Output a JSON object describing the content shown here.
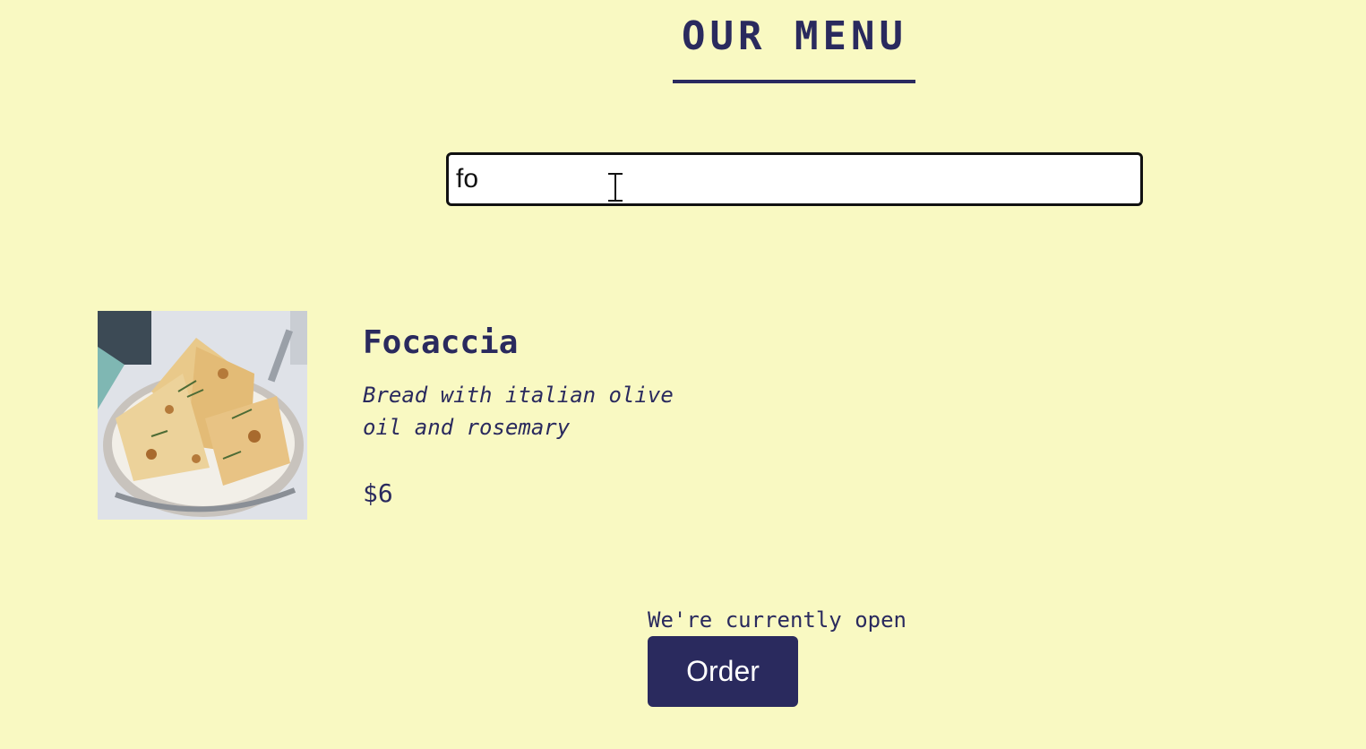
{
  "header": {
    "title": "OUR MENU"
  },
  "search": {
    "value": "fo",
    "placeholder": ""
  },
  "menu_items": [
    {
      "name": "Focaccia",
      "description": "Bread with italian olive oil and rosemary",
      "price": "$6",
      "image_icon": "focaccia-photo"
    }
  ],
  "footer": {
    "status_text": "We're currently open",
    "order_label": "Order"
  },
  "colors": {
    "background": "#f9f9c2",
    "accent": "#2a2a5e",
    "button_text": "#ffffff"
  }
}
